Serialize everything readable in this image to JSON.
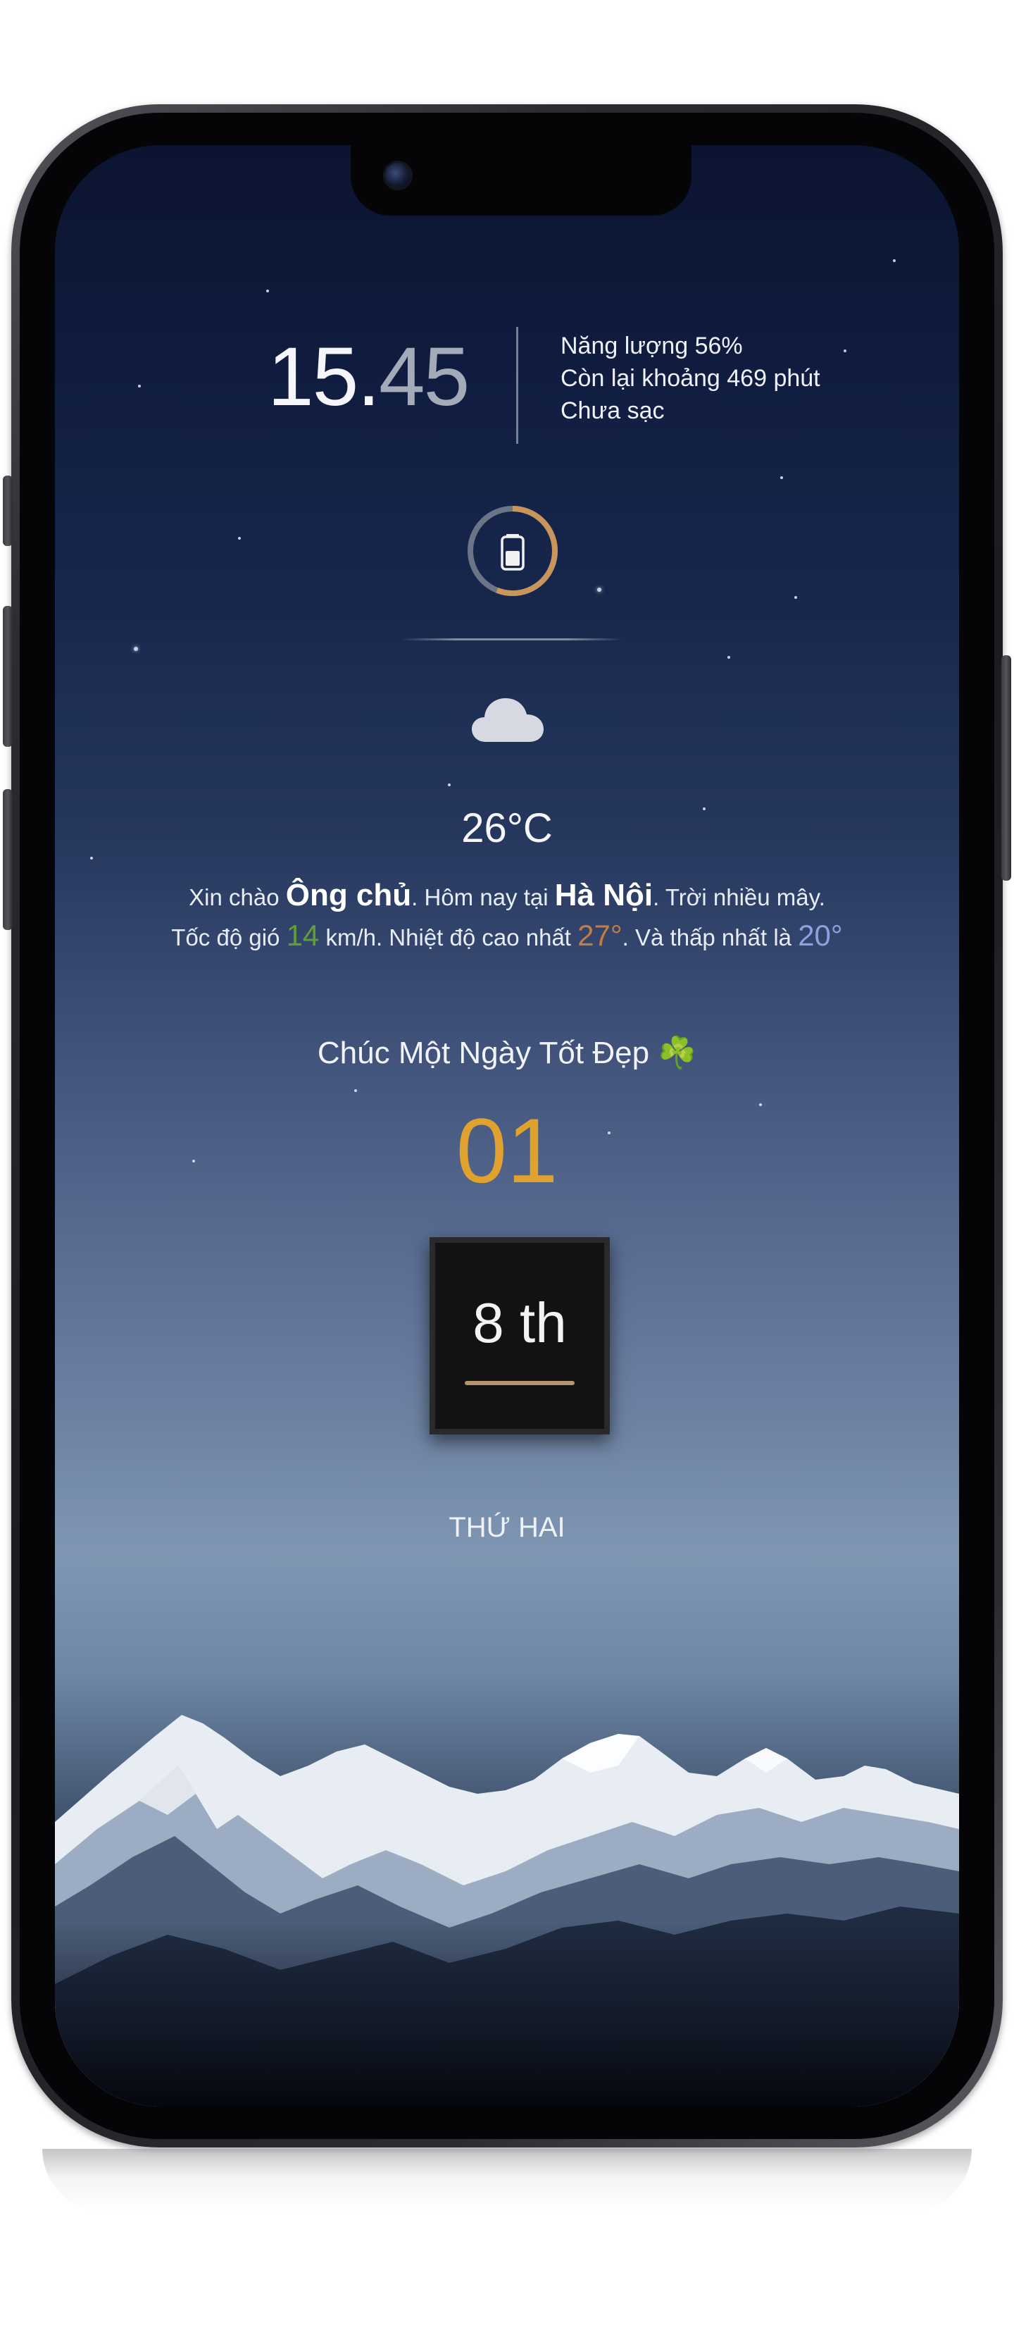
{
  "clock": {
    "hours": "15.",
    "minutes": "45"
  },
  "battery": {
    "level_line": "Năng lượng 56%",
    "remaining_line": "Còn lại khoảng 469 phút",
    "status_line": "Chưa sạc",
    "level_fraction": 0.56,
    "ring_color": "#c8955a",
    "icon": "battery-icon"
  },
  "weather": {
    "icon": "cloud-icon",
    "temperature": "26°C"
  },
  "greeting": {
    "part1": "Xin chào ",
    "name": "Ông chủ",
    "part2": ". Hôm nay tại ",
    "city": "Hà Nội",
    "part3": ". Trời nhiều mây. Tốc độ gió ",
    "wind": "14",
    "part4": " km/h. Nhiệt độ cao nhất ",
    "high": "27°",
    "part5": ". Và thấp nhất là ",
    "low": "20°"
  },
  "wish": {
    "text": "Chúc Một Ngày Tốt Đẹp ",
    "icon_glyph": "☘️"
  },
  "date": {
    "day": "01",
    "month": "8 th",
    "weekday": "THỨ HAI",
    "accent": "#e0a12e"
  }
}
